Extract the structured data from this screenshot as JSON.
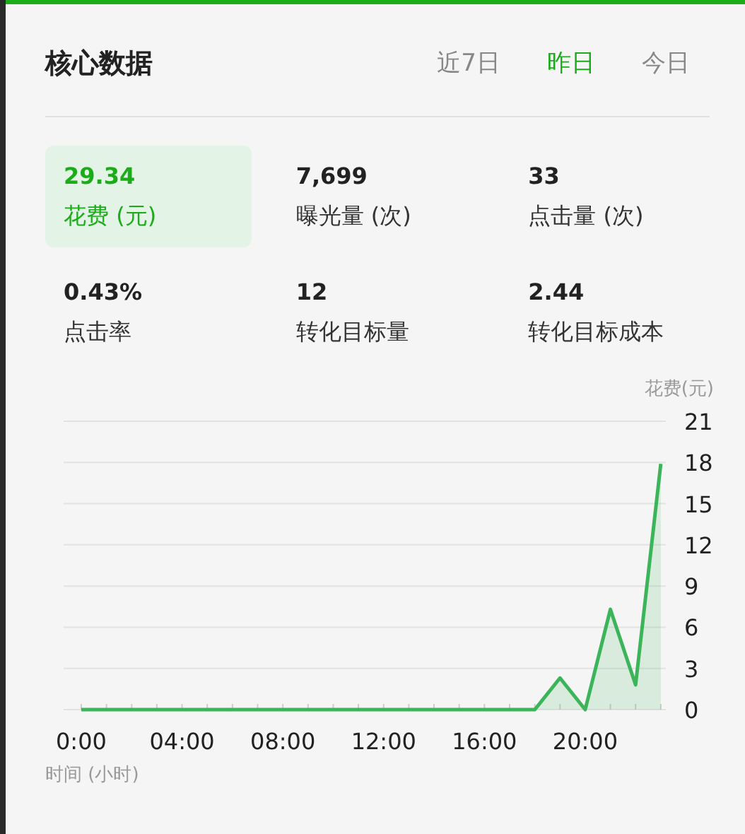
{
  "header": {
    "title": "核心数据",
    "tabs": [
      {
        "label": "近7日",
        "selected": false
      },
      {
        "label": "昨日",
        "selected": true
      },
      {
        "label": "今日",
        "selected": false
      }
    ]
  },
  "metrics": [
    {
      "value": "29.34",
      "label": "花费 (元)",
      "selected": true
    },
    {
      "value": "7,699",
      "label": "曝光量 (次)",
      "selected": false
    },
    {
      "value": "33",
      "label": "点击量 (次)",
      "selected": false
    },
    {
      "value": "0.43%",
      "label": "点击率",
      "selected": false
    },
    {
      "value": "12",
      "label": "转化目标量",
      "selected": false
    },
    {
      "value": "2.44",
      "label": "转化目标成本",
      "selected": false
    }
  ],
  "chart": {
    "chart_data": {
      "type": "area",
      "xlabel": "时间 (小时)",
      "ylabel": "花费(元)",
      "x": [
        0,
        1,
        2,
        3,
        4,
        5,
        6,
        7,
        8,
        9,
        10,
        11,
        12,
        13,
        14,
        15,
        16,
        17,
        18,
        19,
        20,
        21,
        22,
        23
      ],
      "series": [
        {
          "color": "#3cb55a",
          "values": [
            0,
            0,
            0,
            0,
            0,
            0,
            0,
            0,
            0,
            0,
            0,
            0,
            0,
            0,
            0,
            0,
            0,
            0,
            0,
            2.3,
            0,
            7.3,
            1.8,
            17.9
          ]
        }
      ],
      "xlim": [
        -0.7,
        23.2
      ],
      "ylim": [
        0,
        21
      ],
      "grid": true,
      "xticks": [
        {
          "value": 0,
          "label": "0:00"
        },
        {
          "value": 4,
          "label": "04:00"
        },
        {
          "value": 8,
          "label": "08:00"
        },
        {
          "value": 12,
          "label": "12:00"
        },
        {
          "value": 16,
          "label": "16:00"
        },
        {
          "value": 20,
          "label": "20:00"
        }
      ],
      "yticks": [
        0,
        3,
        6,
        9,
        12,
        15,
        18,
        21
      ]
    }
  }
}
